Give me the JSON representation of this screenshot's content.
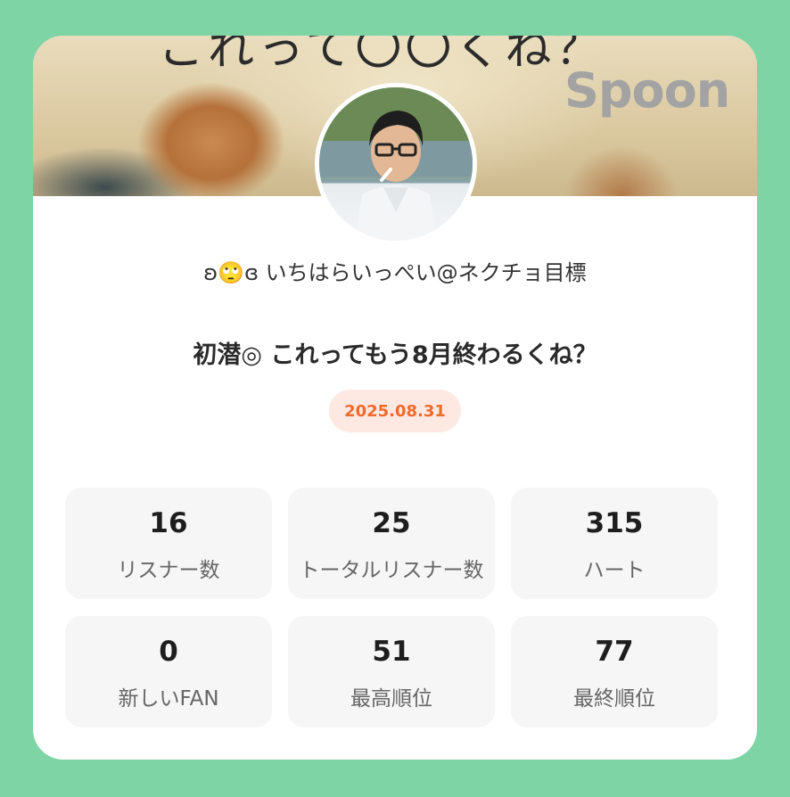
{
  "banner": {
    "caption": "これって〇〇くね？",
    "logo": "Spoon"
  },
  "profile": {
    "username": "ʚ🙄ɞ いちはらいっぺい@ネクチョ目標"
  },
  "broadcast": {
    "title": "初潜◎ これってもう8月終わるくね？",
    "date": "2025.08.31"
  },
  "stats": [
    {
      "value": "16",
      "label": "リスナー数"
    },
    {
      "value": "25",
      "label": "トータルリスナー数"
    },
    {
      "value": "315",
      "label": "ハート"
    },
    {
      "value": "0",
      "label": "新しいFAN"
    },
    {
      "value": "51",
      "label": "最高順位"
    },
    {
      "value": "77",
      "label": "最終順位"
    }
  ],
  "colors": {
    "background": "#7fd4a5",
    "card": "#ffffff",
    "accent": "#f06a2e",
    "badge_bg": "#fde9e1",
    "stat_bg": "#f6f6f6"
  }
}
